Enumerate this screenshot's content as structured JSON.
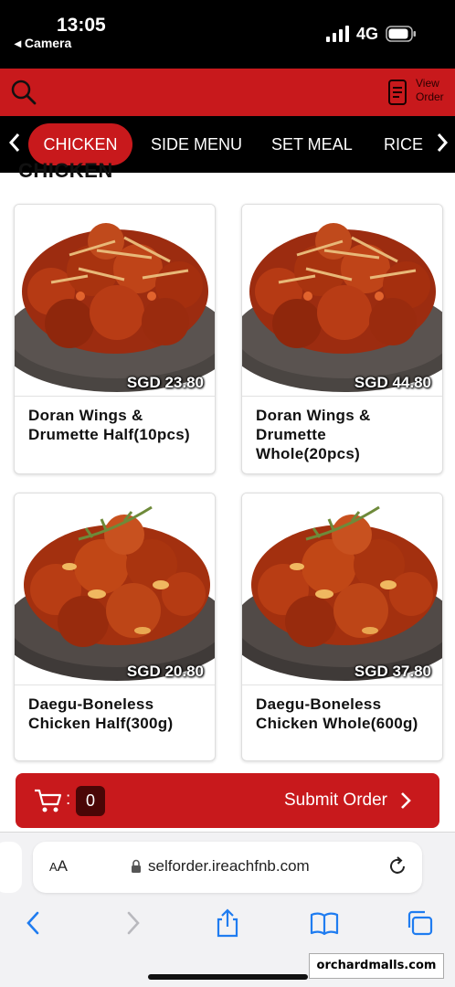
{
  "status_bar": {
    "time": "13:05",
    "back_app": "◂ Camera",
    "network": "4G"
  },
  "header": {
    "search_icon": "search-icon",
    "view_order_line1": "View",
    "view_order_line2": "Order",
    "accent_color": "#c8191c"
  },
  "categories": {
    "tabs": [
      {
        "label": "CHICKEN",
        "active": true
      },
      {
        "label": "SIDE MENU",
        "active": false
      },
      {
        "label": "SET MEAL",
        "active": false
      },
      {
        "label": "RICE",
        "active": false
      }
    ]
  },
  "section": {
    "title": "CHICKEN"
  },
  "menu_items": [
    {
      "name": "Doran Wings & Drumette Half(10pcs)",
      "price": "SGD 23.80",
      "image": "wings"
    },
    {
      "name": "Doran Wings & Drumette Whole(20pcs)",
      "price": "SGD 44.80",
      "image": "wings"
    },
    {
      "name": "Daegu-Boneless Chicken Half(300g)",
      "price": "SGD 20.80",
      "image": "boneless"
    },
    {
      "name": "Daegu-Boneless Chicken Whole(600g)",
      "price": "SGD 37.80",
      "image": "boneless"
    }
  ],
  "order_bar": {
    "colon": ":",
    "cart_count": "0",
    "submit_label": "Submit Order"
  },
  "browser": {
    "aa_label_small": "A",
    "aa_label_large": "A",
    "url": "selforder.ireachfnb.com"
  },
  "watermark": "orchardmalls.com"
}
